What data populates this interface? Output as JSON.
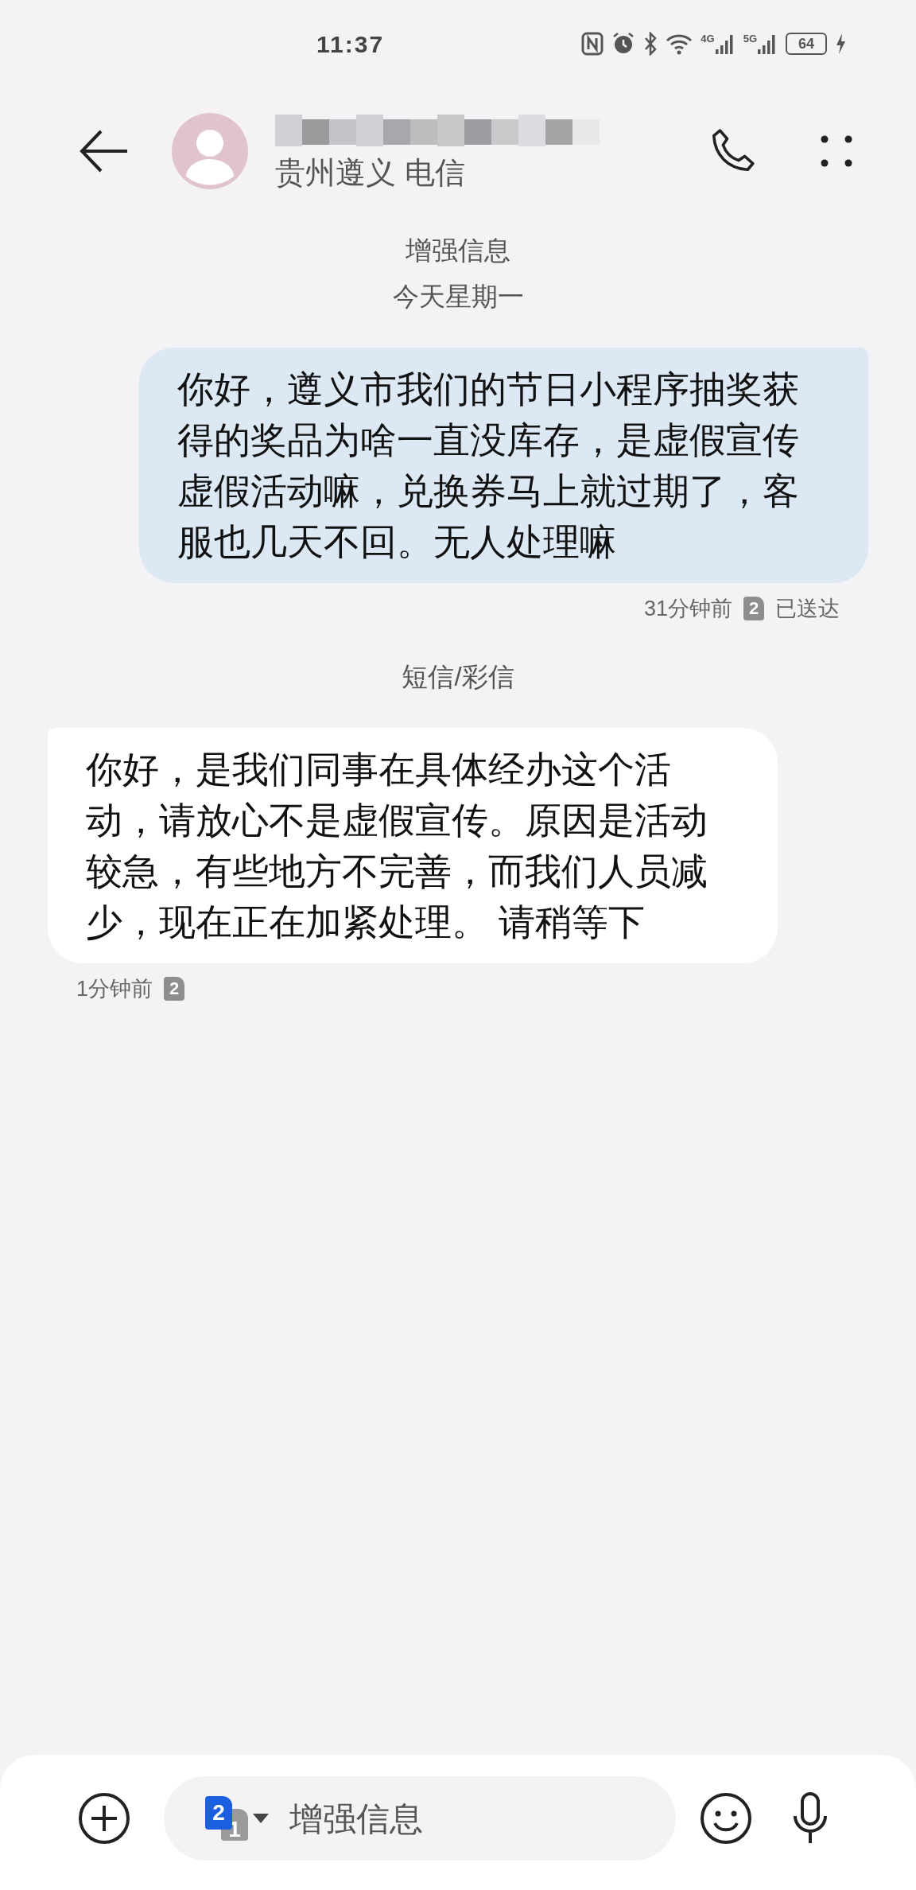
{
  "status_bar": {
    "time": "11:37",
    "network_labels": [
      "4G",
      "5G"
    ],
    "battery": "64"
  },
  "header": {
    "subtitle": "贵州遵义 电信"
  },
  "conversation": [
    {
      "kind": "label",
      "text": "增强信息"
    },
    {
      "kind": "label",
      "text": "今天星期一"
    },
    {
      "kind": "sent",
      "text": "你好，遵义市我们的节日小程序抽奖获得的奖品为啥一直没库存，是虚假宣传虚假活动嘛，兑换券马上就过期了，客服也几天不回。无人处理嘛",
      "time": "31分钟前",
      "sim": "2",
      "status": "已送达"
    },
    {
      "kind": "label",
      "text": "短信/彩信"
    },
    {
      "kind": "received",
      "text": "你好，是我们同事在具体经办这个活动，请放心不是虚假宣传。原因是活动较急，有些地方不完善，而我们人员减少，现在正在加紧处理。 请稍等下",
      "time": "1分钟前",
      "sim": "2"
    }
  ],
  "composer": {
    "sim_front": "2",
    "sim_back": "1",
    "placeholder": "增强信息"
  }
}
